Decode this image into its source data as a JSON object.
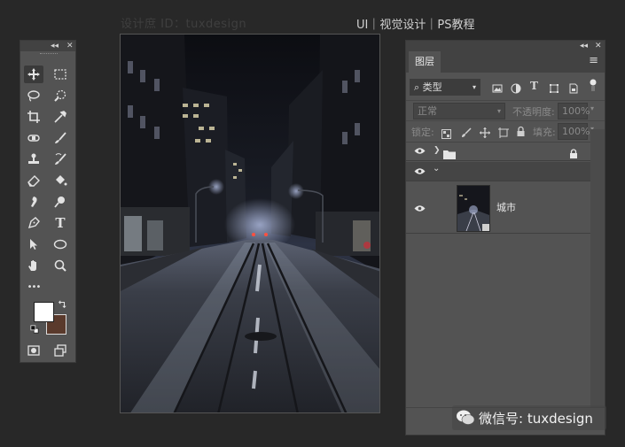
{
  "header": {
    "left_text": "设计庶 ID：tuxdesign",
    "right_text": "UI｜视觉设计｜PS教程"
  },
  "toolbar": {
    "collapse_glyph": "◂◂",
    "close_glyph": "✕",
    "more_glyph": "•••",
    "tools": [
      {
        "name": "move-tool",
        "icon": "move-icon",
        "selected": true
      },
      {
        "name": "marquee-tool",
        "icon": "rect-marquee-icon"
      },
      {
        "name": "lasso-tool",
        "icon": "lasso-icon"
      },
      {
        "name": "quick-select-tool",
        "icon": "quick-select-icon"
      },
      {
        "name": "crop-tool",
        "icon": "crop-icon"
      },
      {
        "name": "eyedropper-tool",
        "icon": "eyedropper-icon"
      },
      {
        "name": "spot-heal-tool",
        "icon": "bandage-icon"
      },
      {
        "name": "brush-tool",
        "icon": "brush-icon"
      },
      {
        "name": "stamp-tool",
        "icon": "stamp-icon"
      },
      {
        "name": "history-brush-tool",
        "icon": "history-brush-icon"
      },
      {
        "name": "eraser-tool",
        "icon": "eraser-icon"
      },
      {
        "name": "bucket-tool",
        "icon": "bucket-icon"
      },
      {
        "name": "smudge-tool",
        "icon": "smudge-icon"
      },
      {
        "name": "dodge-tool",
        "icon": "dodge-icon"
      },
      {
        "name": "pen-tool",
        "icon": "pen-icon"
      },
      {
        "name": "type-tool",
        "icon": "type-icon",
        "glyph": "T"
      },
      {
        "name": "path-select-tool",
        "icon": "arrow-icon"
      },
      {
        "name": "shape-tool",
        "icon": "ellipse-icon"
      },
      {
        "name": "hand-tool",
        "icon": "hand-icon"
      },
      {
        "name": "zoom-tool",
        "icon": "zoom-icon"
      }
    ],
    "foreground_color": "#ffffff",
    "background_color": "#5a3a2c"
  },
  "layers_panel": {
    "collapse_glyph": "◂◂",
    "close_glyph": "✕",
    "tab_label": "图层",
    "menu_glyph": "≡",
    "filter_label": "类型",
    "blend_mode": "正常",
    "opacity_label": "不透明度:",
    "opacity_value": "100%",
    "lock_label": "锁定:",
    "fill_label": "填充:",
    "fill_value": "100%",
    "layers": [
      {
        "type": "group",
        "collapsed": true,
        "locked": true
      },
      {
        "type": "group",
        "collapsed": false
      },
      {
        "type": "pixel",
        "name": "城市"
      }
    ]
  },
  "watermark": {
    "text": "微信号: tuxdesign"
  }
}
